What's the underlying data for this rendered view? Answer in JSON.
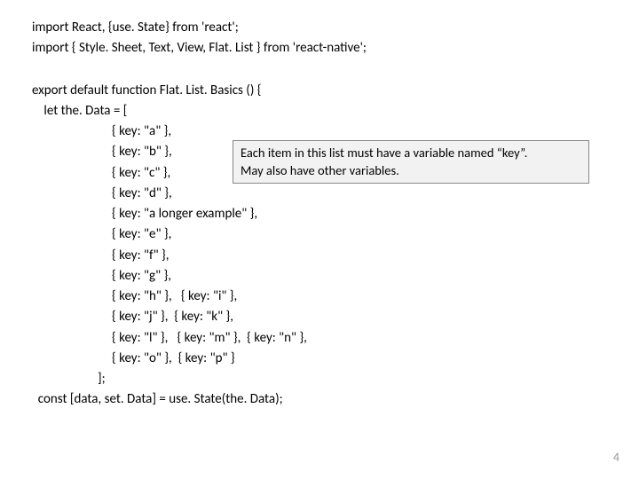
{
  "code": {
    "l1": "import React, {use. State} from 'react';",
    "l2": "import { Style. Sheet, Text, View, Flat. List } from 'react-native';",
    "l3": "export default function Flat. List. Basics () {",
    "l4": " let the. Data = [",
    "l5": "{ key: \"a\" },",
    "l6": "{ key: \"b\" },",
    "l7": "{ key: \"c\" },",
    "l8": "{ key: \"d\" },",
    "l9": "{ key: \"a longer example\" },",
    "l10": "{ key: \"e\" },",
    "l11": "{ key: \"f\" },",
    "l12": "{ key: \"g\" },",
    "l13": "{ key: \"h\" },   { key: \"i\" },",
    "l14": "{ key: \"j\" },  { key: \"k\" },",
    "l15": "{ key: \"l\" },   { key: \"m\" },  { key: \"n\" },",
    "l16": "{ key: \"o\" },  { key: \"p\" }",
    "l17": "];",
    "l18": "  const [data, set. Data] = use. State(the. Data);"
  },
  "callout": {
    "line1": "Each item in this list must have a variable named “key”.",
    "line2": "May also have other variables."
  },
  "page": "4"
}
